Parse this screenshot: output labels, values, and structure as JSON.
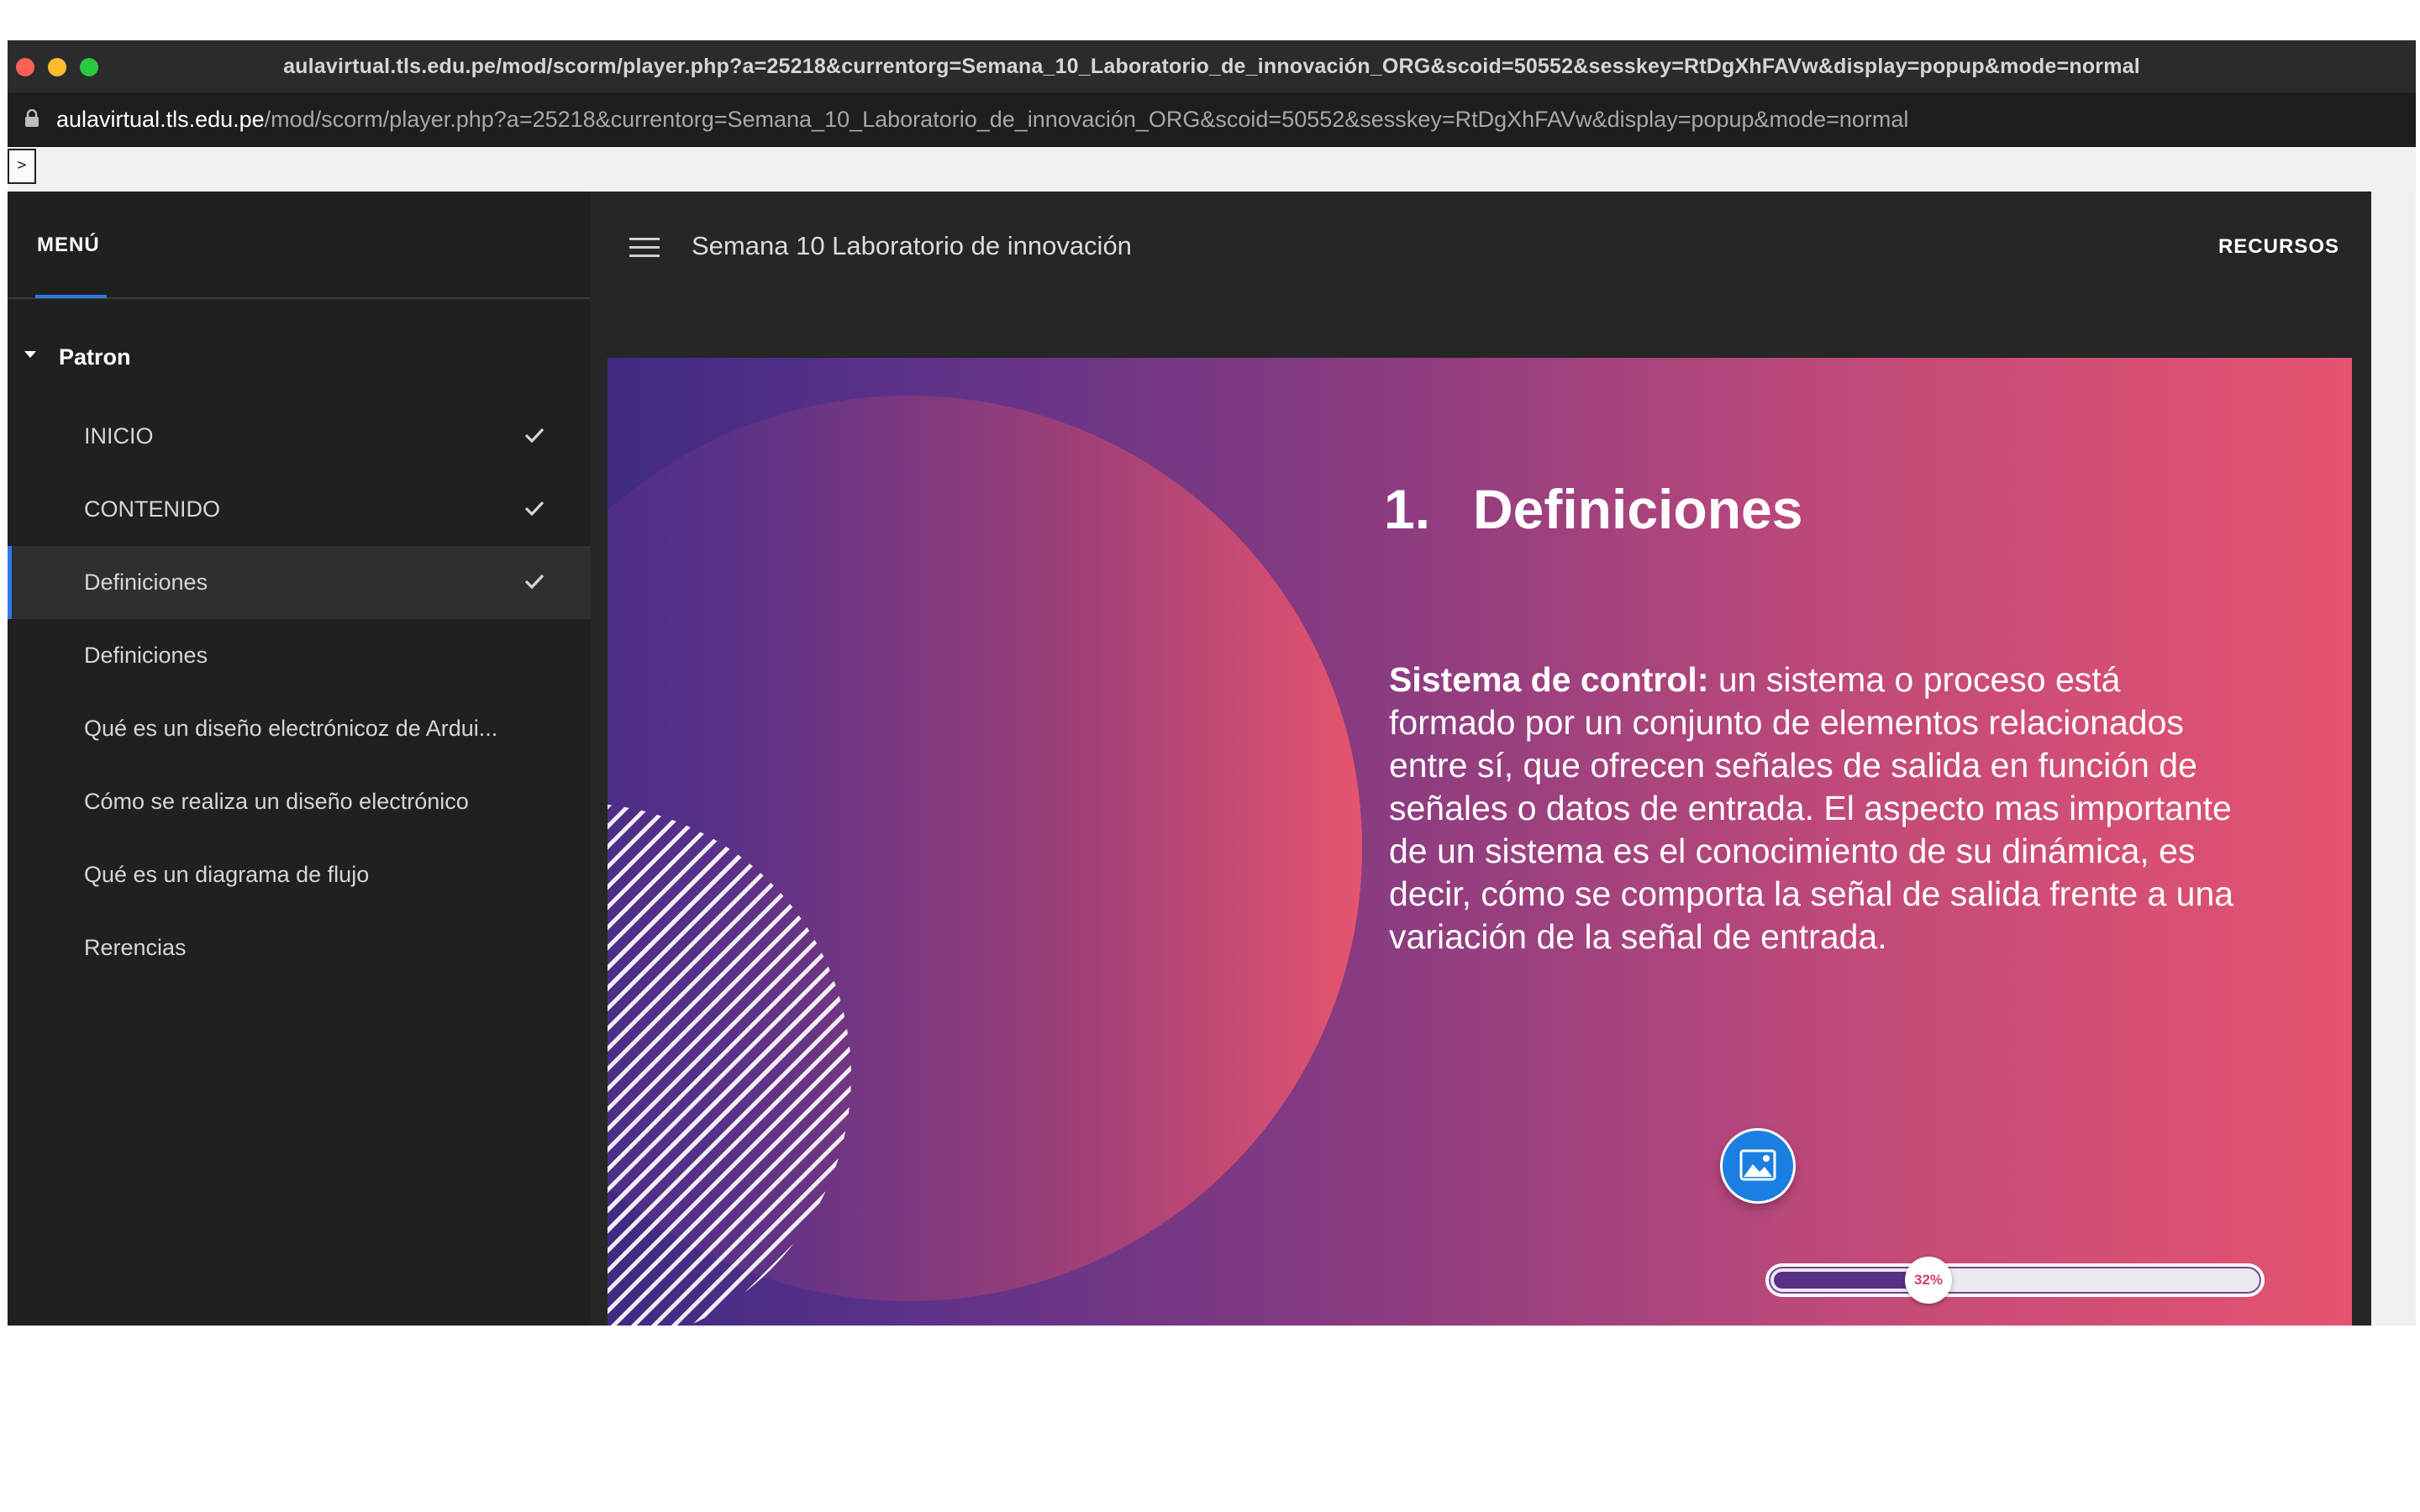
{
  "browser": {
    "window_title": "aulavirtual.tls.edu.pe/mod/scorm/player.php?a=25218&currentorg=Semana_10_Laboratorio_de_innovación_ORG&scoid=50552&sesskey=RtDgXhFAVw&display=popup&mode=normal",
    "url_host": "aulavirtual.tls.edu.pe",
    "url_path": "/mod/scorm/player.php?a=25218&currentorg=Semana_10_Laboratorio_de_innovación_ORG&scoid=50552&sesskey=RtDgXhFAVw&display=popup&mode=normal",
    "toggle_label": ">"
  },
  "sidebar": {
    "menu_title": "MENÚ",
    "group_label": "Patron",
    "items": [
      {
        "label": "INICIO",
        "completed": true
      },
      {
        "label": "CONTENIDO",
        "completed": true
      },
      {
        "label": "Definiciones",
        "completed": true,
        "active": true
      },
      {
        "label": "Definiciones",
        "completed": false
      },
      {
        "label": "Qué es un diseño electrónicoz de Ardui...",
        "completed": false
      },
      {
        "label": "Cómo se realiza un diseño electrónico",
        "completed": false
      },
      {
        "label": "Qué es un diagrama de flujo",
        "completed": false
      },
      {
        "label": "Rerencias",
        "completed": false
      }
    ]
  },
  "header": {
    "course_title": "Semana 10 Laboratorio de innovación",
    "resources_label": "RECURSOS"
  },
  "slide": {
    "number": "1.",
    "heading": "Definiciones",
    "term": "Sistema de control:",
    "body": " un sistema o proceso está formado por un conjunto de elementos relacionados entre sí, que ofrecen señales de salida en función de señales o datos de entrada. El aspecto mas importante de un sistema es el conocimiento de su dinámica, es decir, cómo se comporta la señal de salida frente a una variación de la señal de entrada.",
    "media_icon": "image-icon",
    "progress_label": "32%",
    "progress_fraction": 0.32
  },
  "colors": {
    "accent": "#2c7be5",
    "slide_gradient_start": "#3f2a82",
    "slide_gradient_end": "#e5536f",
    "progress_fill": "#5a2f86",
    "media_button": "#1a7fe0"
  }
}
